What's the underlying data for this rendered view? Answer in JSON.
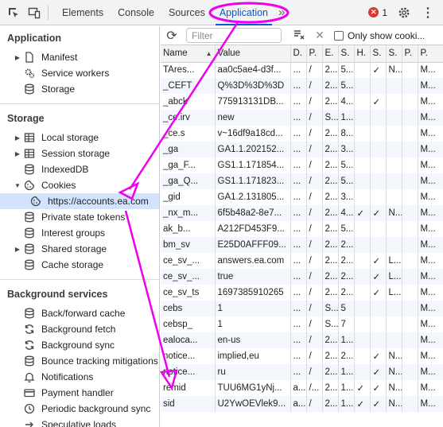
{
  "topbar": {
    "tabs": [
      "Elements",
      "Console",
      "Sources",
      "Application"
    ],
    "active_tab": "Application",
    "error_count": "1"
  },
  "sidebar": {
    "application_title": "Application",
    "application_items": [
      {
        "label": "Manifest",
        "icon": "file-icon",
        "arrow": true
      },
      {
        "label": "Service workers",
        "icon": "gear-icon",
        "arrow": false
      },
      {
        "label": "Storage",
        "icon": "database-icon",
        "arrow": false
      }
    ],
    "storage_title": "Storage",
    "storage_items": [
      {
        "label": "Local storage",
        "icon": "grid-icon",
        "arrow": true
      },
      {
        "label": "Session storage",
        "icon": "grid-icon",
        "arrow": true
      },
      {
        "label": "IndexedDB",
        "icon": "database-icon",
        "arrow": false
      },
      {
        "label": "Cookies",
        "icon": "cookie-icon",
        "arrow": true,
        "expanded": true
      },
      {
        "label": "https://accounts.ea.com",
        "icon": "cookie-icon",
        "child": true,
        "selected": true
      },
      {
        "label": "Private state tokens",
        "icon": "database-icon",
        "arrow": false
      },
      {
        "label": "Interest groups",
        "icon": "database-icon",
        "arrow": false
      },
      {
        "label": "Shared storage",
        "icon": "database-icon",
        "arrow": true
      },
      {
        "label": "Cache storage",
        "icon": "database-icon",
        "arrow": false
      }
    ],
    "background_title": "Background services",
    "background_items": [
      {
        "label": "Back/forward cache",
        "icon": "database-icon"
      },
      {
        "label": "Background fetch",
        "icon": "sync-icon"
      },
      {
        "label": "Background sync",
        "icon": "sync-icon"
      },
      {
        "label": "Bounce tracking mitigations",
        "icon": "database-icon"
      },
      {
        "label": "Notifications",
        "icon": "bell-icon"
      },
      {
        "label": "Payment handler",
        "icon": "card-icon"
      },
      {
        "label": "Periodic background sync",
        "icon": "clock-icon"
      },
      {
        "label": "Speculative loads",
        "icon": "arrow-icon"
      }
    ]
  },
  "toolbar": {
    "filter_placeholder": "Filter",
    "only_show_label": "Only show cooki..."
  },
  "table": {
    "headers": [
      "Name",
      "Value",
      "D.",
      "P.",
      "E.",
      "S.",
      "H.",
      "S.",
      "S.",
      "P.",
      "P."
    ],
    "rows": [
      [
        "TAres...",
        "aa0c5ae4-d3f...",
        "...",
        "/",
        "2...",
        "5...",
        "",
        "✓",
        "N...",
        "",
        "M..."
      ],
      [
        "_CEFT",
        "Q%3D%3D%3D",
        "...",
        "/",
        "2...",
        "5...",
        "",
        "",
        "",
        "",
        "M..."
      ],
      [
        "_abck",
        "775913131DB...",
        "...",
        "/",
        "2...",
        "4...",
        "",
        "✓",
        "",
        "",
        "M..."
      ],
      [
        "_ce.irv",
        "new",
        "...",
        "/",
        "S...",
        "1...",
        "",
        "",
        "",
        "",
        "M..."
      ],
      [
        "_ce.s",
        "v~16df9a18cd...",
        "...",
        "/",
        "2...",
        "8...",
        "",
        "",
        "",
        "",
        "M..."
      ],
      [
        "_ga",
        "GA1.1.202152...",
        "...",
        "/",
        "2...",
        "3...",
        "",
        "",
        "",
        "",
        "M..."
      ],
      [
        "_ga_F...",
        "GS1.1.171854...",
        "...",
        "/",
        "2...",
        "5...",
        "",
        "",
        "",
        "",
        "M..."
      ],
      [
        "_ga_Q...",
        "GS1.1.171823...",
        "...",
        "/",
        "2...",
        "5...",
        "",
        "",
        "",
        "",
        "M..."
      ],
      [
        "_gid",
        "GA1.2.131805...",
        "...",
        "/",
        "2...",
        "3...",
        "",
        "",
        "",
        "",
        "M..."
      ],
      [
        "_nx_m...",
        "6f5b48a2-8e7...",
        "...",
        "/",
        "2...",
        "4...",
        "✓",
        "✓",
        "N...",
        "",
        "M..."
      ],
      [
        "ak_b...",
        "A212FD453F9...",
        "...",
        "/",
        "2...",
        "5...",
        "",
        "",
        "",
        "",
        "M..."
      ],
      [
        "bm_sv",
        "E25D0AFFF09...",
        "...",
        "/",
        "2...",
        "2...",
        "",
        "",
        "",
        "",
        "M..."
      ],
      [
        "ce_sv_...",
        "answers.ea.com",
        "...",
        "/",
        "2...",
        "2...",
        "",
        "✓",
        "L...",
        "",
        "M..."
      ],
      [
        "ce_sv_...",
        "true",
        "...",
        "/",
        "2...",
        "2...",
        "",
        "✓",
        "L...",
        "",
        "M..."
      ],
      [
        "ce_sv_ts",
        "1697385910265",
        "...",
        "/",
        "2...",
        "2...",
        "",
        "✓",
        "L...",
        "",
        "M..."
      ],
      [
        "cebs",
        "1",
        "...",
        "/",
        "S...",
        "5",
        "",
        "",
        "",
        "",
        "M..."
      ],
      [
        "cebsp_",
        "1",
        "...",
        "/",
        "S...",
        "7",
        "",
        "",
        "",
        "",
        "M..."
      ],
      [
        "ealoca...",
        "en-us",
        "...",
        "/",
        "2...",
        "1...",
        "",
        "",
        "",
        "",
        "M..."
      ],
      [
        "notice...",
        "implied,eu",
        "...",
        "/",
        "2...",
        "2...",
        "",
        "✓",
        "N...",
        "",
        "M..."
      ],
      [
        "notice...",
        "ru",
        "...",
        "/",
        "2...",
        "1...",
        "",
        "✓",
        "N...",
        "",
        "M..."
      ],
      [
        "remid",
        "TUU6MG1yNj...",
        "a...",
        "/...",
        "2...",
        "1...",
        "✓",
        "✓",
        "N...",
        "",
        "M..."
      ],
      [
        "sid",
        "U2YwOEVlek9...",
        "a...",
        "/",
        "2...",
        "1...",
        "✓",
        "✓",
        "N...",
        "",
        "M..."
      ]
    ]
  },
  "colors": {
    "accent": "#0b57d0",
    "annotation": "#ee00ee",
    "selected_row": "#d3e3fd",
    "error": "#dc362e"
  }
}
